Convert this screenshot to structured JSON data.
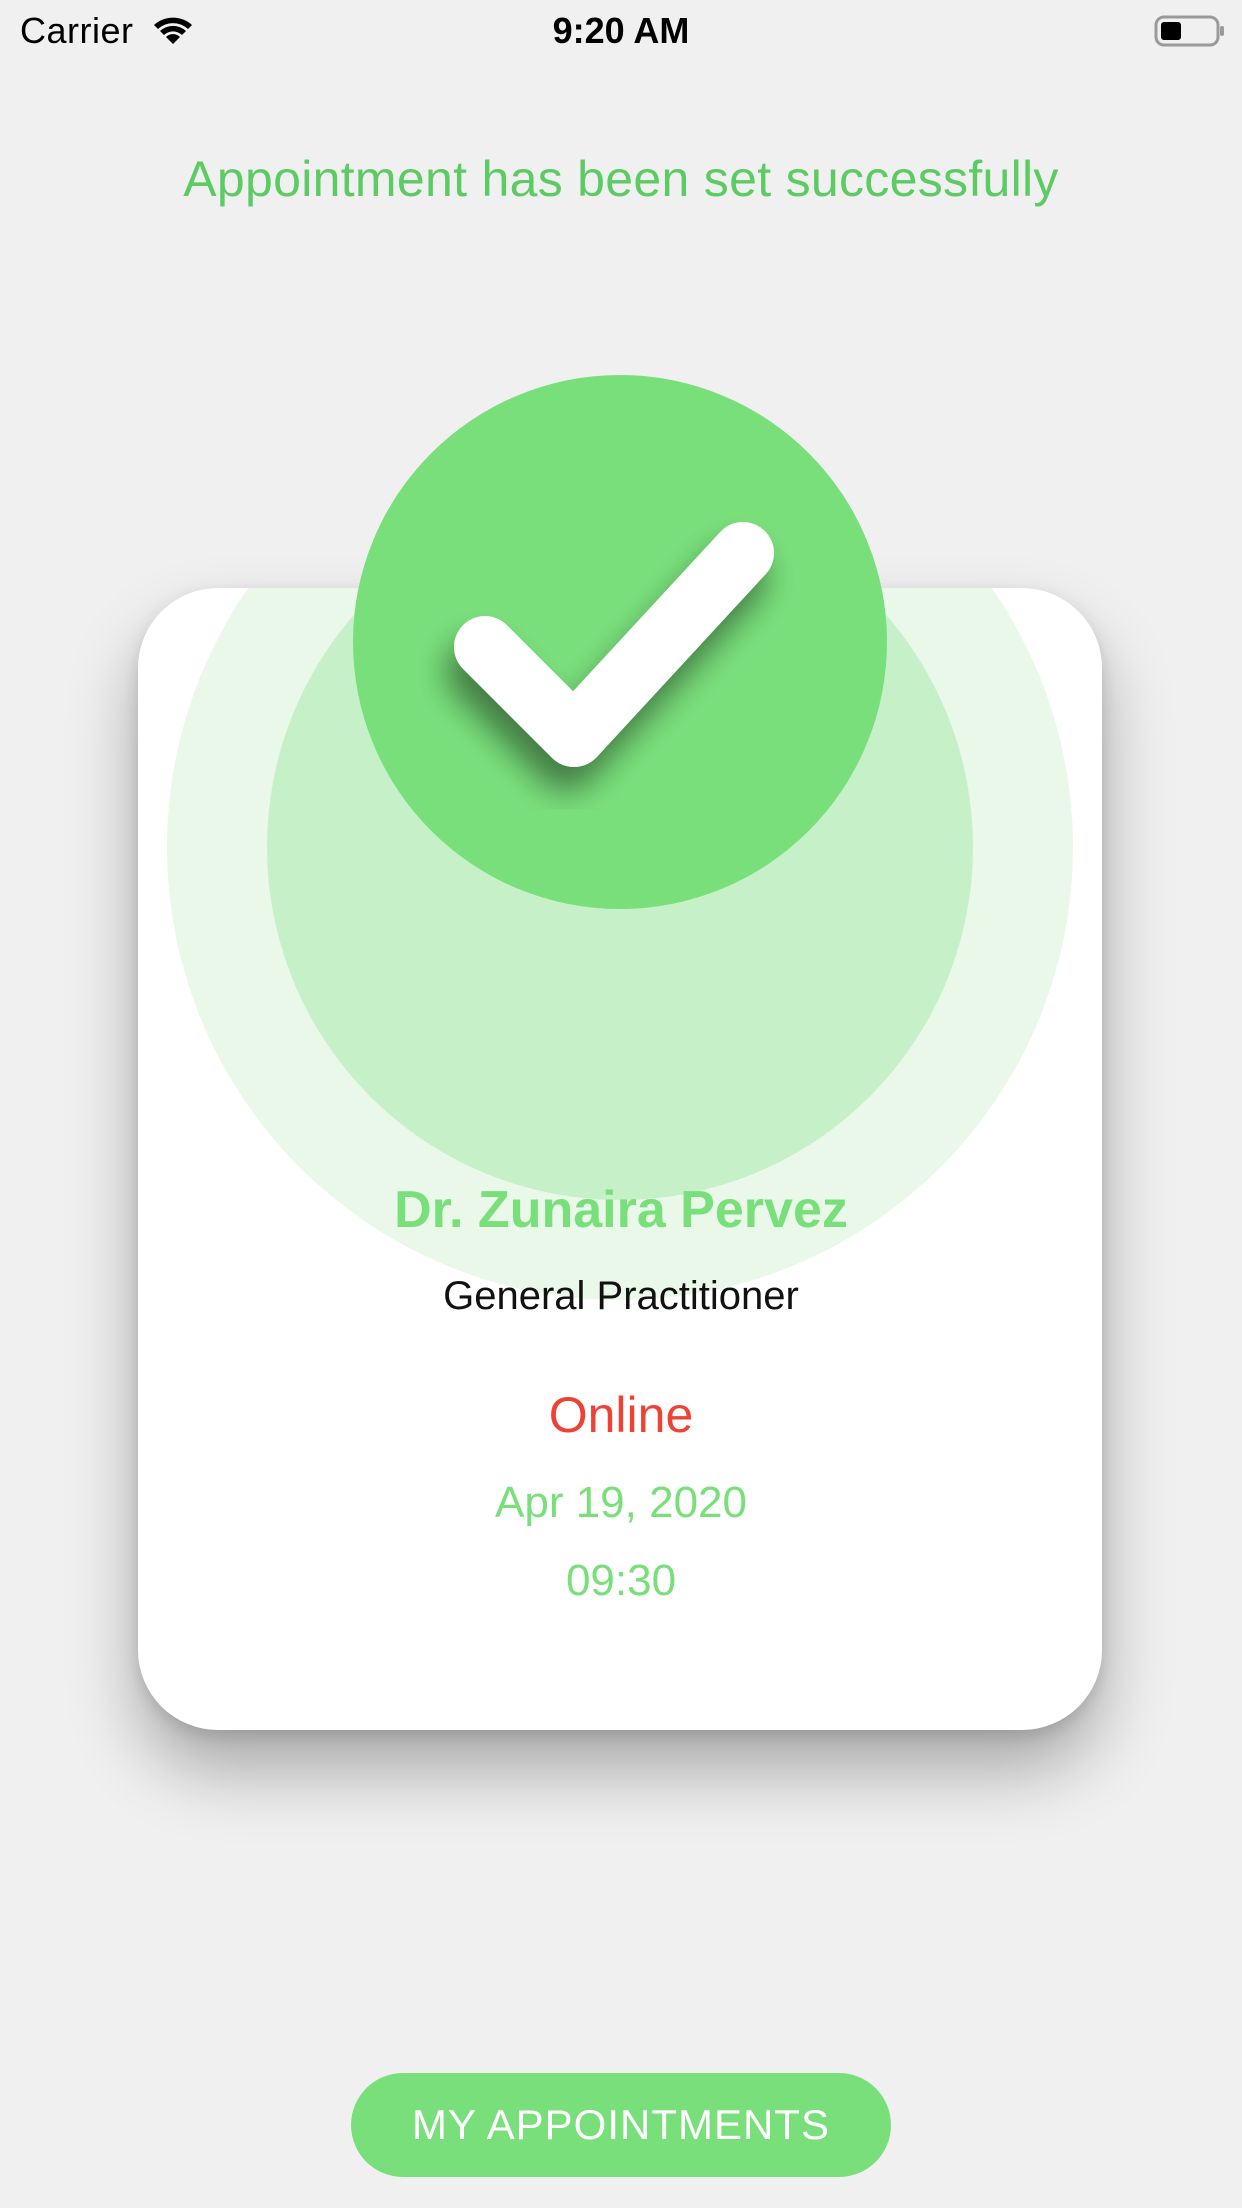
{
  "status_bar": {
    "carrier": "Carrier",
    "time": "9:20 AM",
    "wifi_icon": "wifi-icon",
    "battery_icon": "battery-icon"
  },
  "headline": "Appointment has been set successfully",
  "card": {
    "status_icon": "checkmark-icon",
    "doctor_name": "Dr. Zunaira Pervez",
    "speciality": "General Practitioner",
    "mode": "Online",
    "date": "Apr 19, 2020",
    "time": "09:30"
  },
  "button": {
    "label": "MY APPOINTMENTS"
  },
  "colors": {
    "accent_green": "#79df7b",
    "headline_green": "#5dcb64",
    "ring_light": "#e9f8e8",
    "ring_mid": "#c5f0c8",
    "online_red": "#ef4236",
    "background": "#f0f0f0"
  }
}
